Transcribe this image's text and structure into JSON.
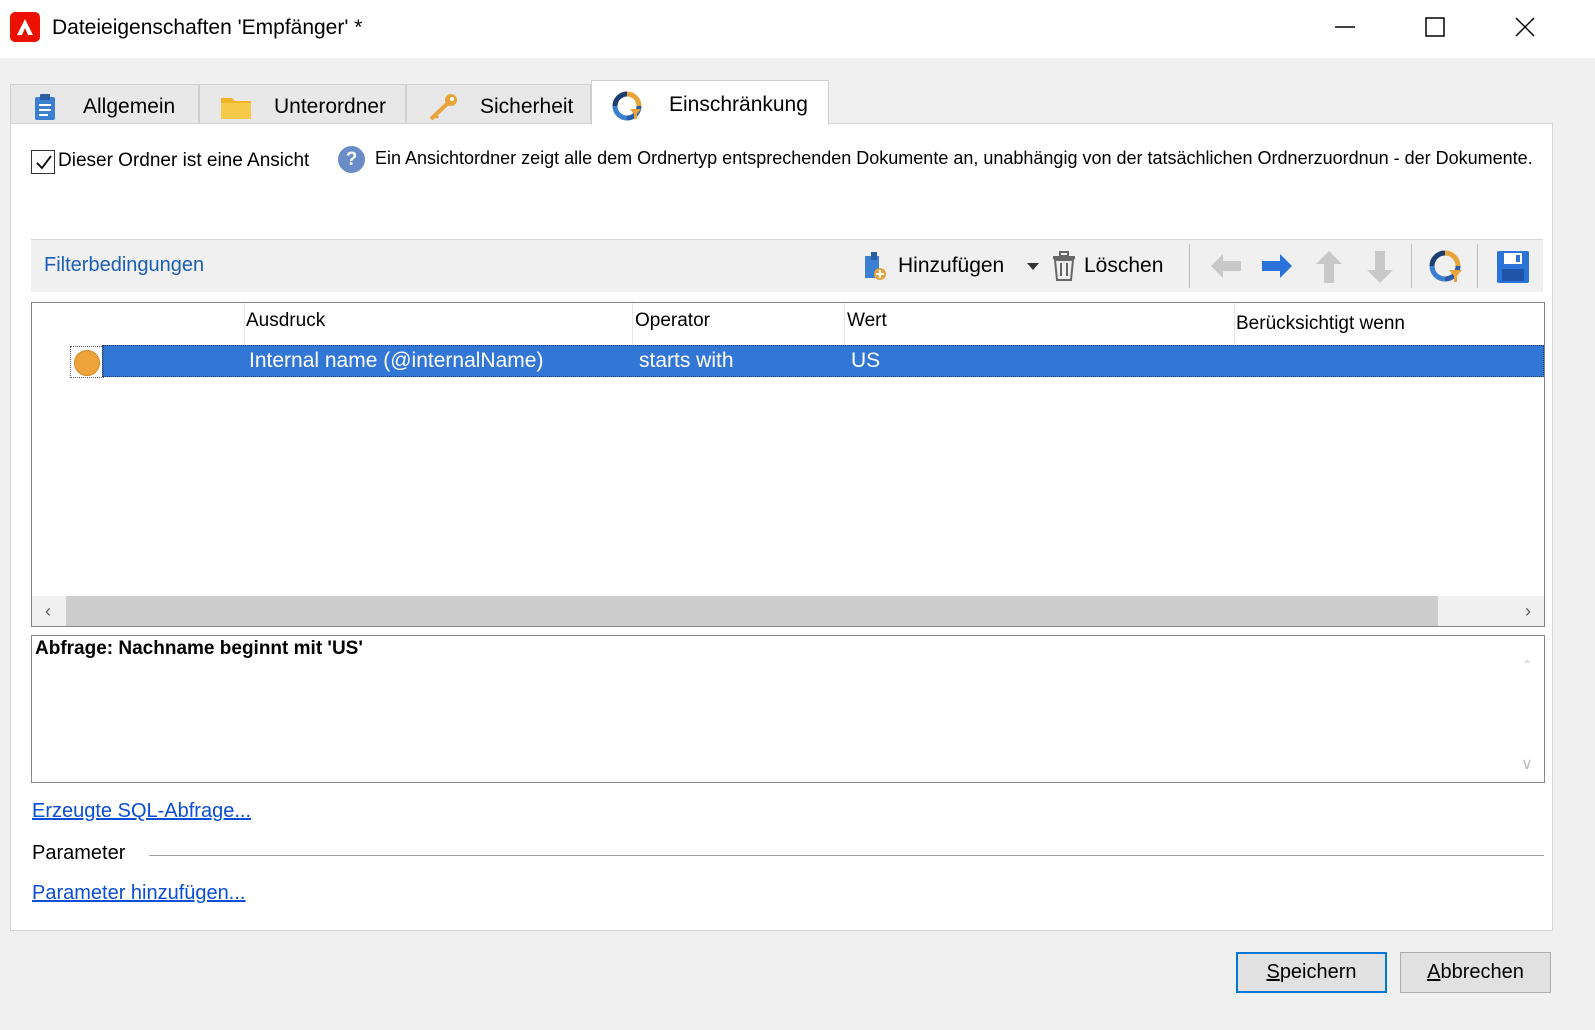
{
  "window": {
    "title": "Dateieigenschaften 'Empfänger' *"
  },
  "tabs": [
    {
      "label": "Allgemein",
      "icon": "clipboard-icon",
      "active": false
    },
    {
      "label": "Unterordner",
      "icon": "folder-icon",
      "active": false
    },
    {
      "label": "Sicherheit",
      "icon": "key-icon",
      "active": false
    },
    {
      "label": "Einschränkung",
      "icon": "filter-icon",
      "active": true
    }
  ],
  "view": {
    "checkbox_label": "Dieser Ordner ist eine Ansicht",
    "checked": true,
    "help_text": "Ein Ansichtordner zeigt alle dem Ordnertyp entsprechenden Dokumente an, unabhängig von der tatsächlichen Ordnerzuordnun - der Dokumente."
  },
  "toolbar": {
    "title": "Filterbedingungen",
    "add_label": "Hinzufügen",
    "delete_label": "Löschen"
  },
  "grid": {
    "columns": [
      "Ausdruck",
      "Operator",
      "Wert",
      "Berücksichtigt wenn"
    ],
    "rows": [
      {
        "expression": "Internal name (@internalName)",
        "operator": "starts with",
        "value": "US",
        "condition": "",
        "selected": true
      }
    ]
  },
  "query": {
    "text": "Abfrage: Nachname beginnt mit 'US'"
  },
  "links": {
    "sql": "Erzeugte SQL-Abfrage...",
    "add_param": "Parameter hinzufügen..."
  },
  "params": {
    "label": "Parameter"
  },
  "buttons": {
    "save_underline": "S",
    "save_rest": "peichern",
    "cancel_underline": "A",
    "cancel_rest": "bbrechen"
  },
  "colors": {
    "accent": "#3277d6",
    "brand": "#eb1000",
    "link": "#0a4dd6",
    "status_dot": "#eda33a"
  }
}
